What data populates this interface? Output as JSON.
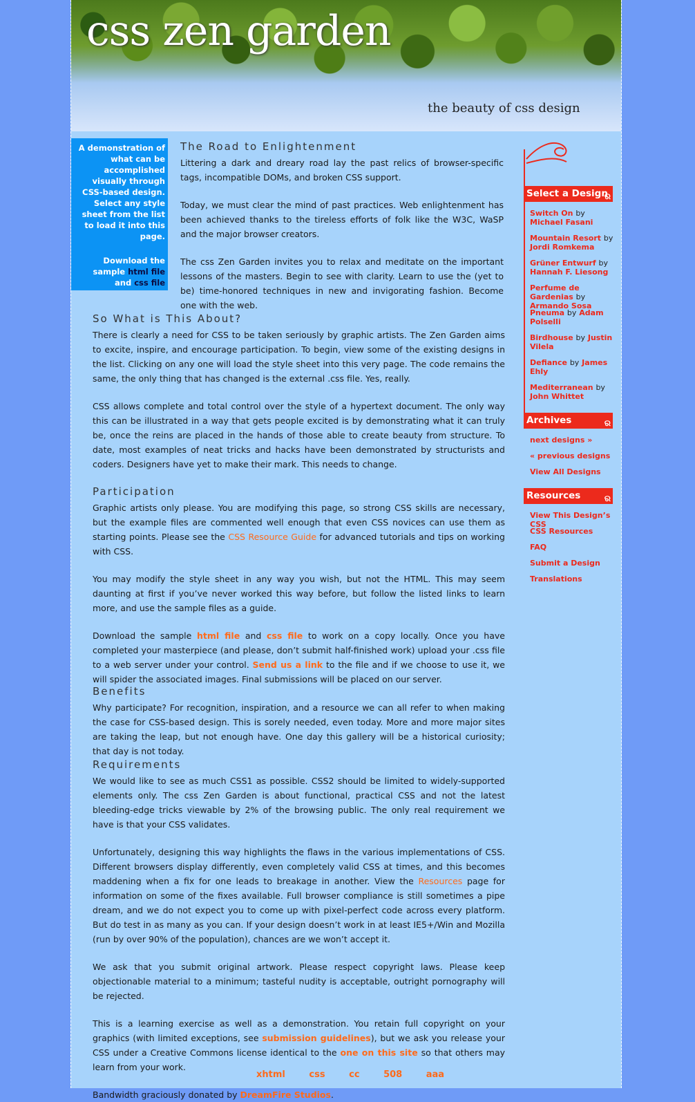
{
  "header": {
    "title": "css zen garden",
    "tagline": "the beauty of css design"
  },
  "intro": {
    "text": "A demonstration of what can be accomplished visually through CSS-based design. Select any style sheet from the list to load it into this page.",
    "download_prefix": "Download the sample",
    "html_file": "html file",
    "and": "and",
    "css_file": "css file"
  },
  "main": {
    "road": {
      "heading": "The Road to Enlightenment",
      "p1": "Littering a dark and dreary road lay the past relics of browser-specific tags, incompatible DOMs, and broken CSS support.",
      "p2": "Today, we must clear the mind of past practices. Web enlightenment has been achieved thanks to the tireless efforts of folk like the W3C, WaSP and the major browser creators.",
      "p3": "The css Zen Garden invites you to relax and meditate on the important lessons of the masters. Begin to see with clarity. Learn to use the (yet to be) time-honored techniques in new and invigorating fashion. Become one with the web."
    },
    "about": {
      "heading": "So What is This About?",
      "p1": "There is clearly a need for CSS to be taken seriously by graphic artists. The Zen Garden aims to excite, inspire, and encourage participation. To begin, view some of the existing designs in the list. Clicking on any one will load the style sheet into this very page. The code remains the same, the only thing that has changed is the external .css file. Yes, really.",
      "p2": "CSS allows complete and total control over the style of a hypertext document. The only way this can be illustrated in a way that gets people excited is by demonstrating what it can truly be, once the reins are placed in the hands of those able to create beauty from structure. To date, most examples of neat tricks and hacks have been demonstrated by structurists and coders. Designers have yet to make their mark. This needs to change."
    },
    "participation": {
      "heading": "Participation",
      "p1_pre": "Graphic artists only please. You are modifying this page, so strong CSS skills are necessary, but the example files are commented well enough that even CSS novices can use them as starting points. Please see the",
      "p1_link": "CSS Resource Guide",
      "p1_post": "for advanced tutorials and tips on working with CSS.",
      "p2": "You may modify the style sheet in any way you wish, but not the HTML. This may seem daunting at first if you’ve never worked this way before, but follow the listed links to learn more, and use the sample files as a guide.",
      "p3_a": "Download the sample",
      "p3_html": "html file",
      "p3_b": "and",
      "p3_css": "css file",
      "p3_c": "to work on a copy locally. Once you have completed your masterpiece (and please, don’t submit half-finished work) upload your .css file to a web server under your control.",
      "p3_link": "Send us a link",
      "p3_d": "to the file and if we choose to use it, we will spider the associated images. Final submissions will be placed on our server."
    },
    "benefits": {
      "heading": "Benefits",
      "p1": "Why participate? For recognition, inspiration, and a resource we can all refer to when making the case for CSS-based design. This is sorely needed, even today. More and more major sites are taking the leap, but not enough have. One day this gallery will be a historical curiosity; that day is not today."
    },
    "requirements": {
      "heading": "Requirements",
      "p1": "We would like to see as much CSS1 as possible. CSS2 should be limited to widely-supported elements only. The css Zen Garden is about functional, practical CSS and not the latest bleeding-edge tricks viewable by 2% of the browsing public. The only real requirement we have is that your CSS validates.",
      "p2_pre": "Unfortunately, designing this way highlights the flaws in the various implementations of CSS. Different browsers display differently, even completely valid CSS at times, and this becomes maddening when a fix for one leads to breakage in another. View the",
      "p2_link": "Resources",
      "p2_post": "page for information on some of the fixes available. Full browser compliance is still sometimes a pipe dream, and we do not expect you to come up with pixel-perfect code across every platform. But do test in as many as you can. If your design doesn’t work in at least IE5+/Win and Mozilla (run by over 90% of the population), chances are we won’t accept it.",
      "p3": "We ask that you submit original artwork. Please respect copyright laws. Please keep objectionable material to a minimum; tasteful nudity is acceptable, outright pornography will be rejected.",
      "p4_a": "This is a learning exercise as well as a demonstration. You retain full copyright on your graphics (with limited exceptions, see",
      "p4_link1": "submission guidelines",
      "p4_b": "), but we ask you release your CSS under a Creative Commons license identical to the",
      "p4_link2": "one on this site",
      "p4_c": "so that others may learn from your work.",
      "p5_pre": "Bandwidth graciously donated by",
      "p5_link": "DreamFire Studios",
      "p5_post": "."
    }
  },
  "sidebar": {
    "select_heading": "Select a Design",
    "by": "by",
    "designs": [
      {
        "name": "Switch On",
        "author": "Michael Fasani"
      },
      {
        "name": "Mountain Resort",
        "author": "Jordi Romkema"
      },
      {
        "name": "Grüner Entwurf",
        "author": "Hannah F. Liesong"
      },
      {
        "name": "Perfume de Gardenias",
        "author": "Armando Sosa"
      },
      {
        "name": "Pneuma",
        "author": "Adam Polselli"
      },
      {
        "name": "Birdhouse",
        "author": "Justin Vilela"
      },
      {
        "name": "Defiance",
        "author": "James Ehly"
      },
      {
        "name": "Mediterranean",
        "author": "John Whittet"
      }
    ],
    "archives_heading": "Archives",
    "archives": [
      "next designs »",
      "« previous designs",
      "View All Designs"
    ],
    "resources_heading": "Resources",
    "resources": [
      "View This Design’s CSS",
      "CSS Resources",
      "FAQ",
      "Submit a Design",
      "Translations"
    ]
  },
  "footer": {
    "links": [
      "xhtml",
      "css",
      "cc",
      "508",
      "aaa"
    ]
  },
  "colors": {
    "background": "#6f9bf7",
    "page": "#a7d3fb",
    "intro_box": "#0c93f4",
    "accent_red": "#ec2a1c",
    "link_orange": "#ff6a1a"
  }
}
